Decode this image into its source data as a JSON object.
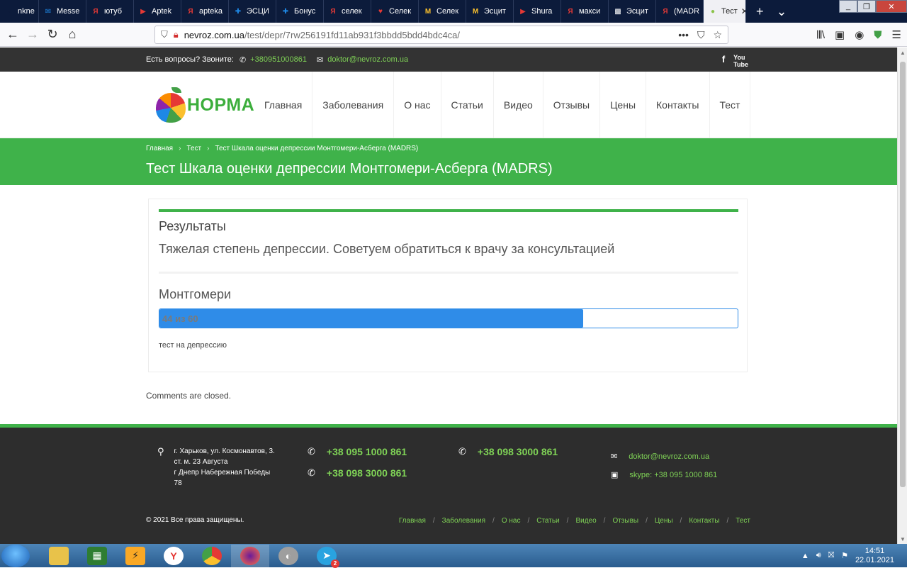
{
  "browser": {
    "tabs": [
      {
        "label": "nkne",
        "icon": "back-arrow-icon",
        "icon_color": "#0c1b3b"
      },
      {
        "label": "Messe",
        "icon": "messenger-icon",
        "icon_color": "#1e88e5"
      },
      {
        "label": "ютуб",
        "icon": "yandex-icon",
        "icon_color": "#e53935"
      },
      {
        "label": "Aptek",
        "icon": "youtube-icon",
        "icon_color": "#e53935"
      },
      {
        "label": "apteka",
        "icon": "yandex-icon",
        "icon_color": "#e53935"
      },
      {
        "label": "ЭСЦИ",
        "icon": "plus-icon",
        "icon_color": "#1e88e5"
      },
      {
        "label": "Бонус",
        "icon": "plus-icon",
        "icon_color": "#1e88e5"
      },
      {
        "label": "селек",
        "icon": "yandex-icon",
        "icon_color": "#e53935"
      },
      {
        "label": "Селек",
        "icon": "heart-icon",
        "icon_color": "#e53935"
      },
      {
        "label": "Селек",
        "icon": "m-logo-icon",
        "icon_color": "#fbc02d"
      },
      {
        "label": "Эсцит",
        "icon": "m-logo-icon",
        "icon_color": "#fbc02d"
      },
      {
        "label": "Shura",
        "icon": "youtube-icon",
        "icon_color": "#e53935"
      },
      {
        "label": "макси",
        "icon": "yandex-icon",
        "icon_color": "#e53935"
      },
      {
        "label": "Эсцит",
        "icon": "qr-icon",
        "icon_color": "#ffffff"
      },
      {
        "label": "(MADR",
        "icon": "yandex-icon",
        "icon_color": "#e53935"
      },
      {
        "label": "Тест",
        "icon": "apple-logo-icon",
        "icon_color": "#8bc34a",
        "active": true
      }
    ],
    "url_host": "nevroz.com.ua",
    "url_path": "/test/depr/7rw256191fd11ab931f3bbdd5bdd4bdc4ca/"
  },
  "site": {
    "topbar": {
      "question": "Есть вопросы? Звоните:",
      "phone": "+380951000861",
      "email": "doktor@nevroz.com.ua"
    },
    "logo_text": "НОРМА",
    "nav": [
      "Главная",
      "Заболевания",
      "О нас",
      "Статьи",
      "Видео",
      "Отзывы",
      "Цены",
      "Контакты",
      "Тест"
    ],
    "breadcrumbs": [
      "Главная",
      "Тест",
      "Тест Шкала оценки депрессии Монтгомери-Асберга (MADRS)"
    ],
    "page_title": "Тест Шкала оценки депрессии Монтгомери-Асберга (MADRS)",
    "results": {
      "heading": "Результаты",
      "text": "Тяжелая степень депрессии. Советуем обратиться к врачу за консультацией",
      "scale_name": "Монтгомери",
      "score": 44,
      "max": 60,
      "score_label": "44 из 60",
      "note": "тест на депрессию"
    },
    "comments": "Comments are closed.",
    "footer": {
      "address_lines": [
        "г. Харьков, ул. Космонавтов, 3.",
        "ст. м. 23 Августа",
        "г Днепр Набережная Победы",
        "78"
      ],
      "phones_col1": [
        "+38 095 1000 861",
        "+38 098 3000 861"
      ],
      "phone_col2": "+38 098 3000 861",
      "email": "doktor@nevroz.com.ua",
      "skype": "skype: +38 095 1000 861",
      "copyright": "© 2021 Все права защищены.",
      "nav": [
        "Главная",
        "Заболевания",
        "О нас",
        "Статьи",
        "Видео",
        "Отзывы",
        "Цены",
        "Контакты",
        "Тест"
      ]
    }
  },
  "taskbar": {
    "time": "14:51",
    "date": "22.01.2021",
    "telegram_badge": "2"
  }
}
